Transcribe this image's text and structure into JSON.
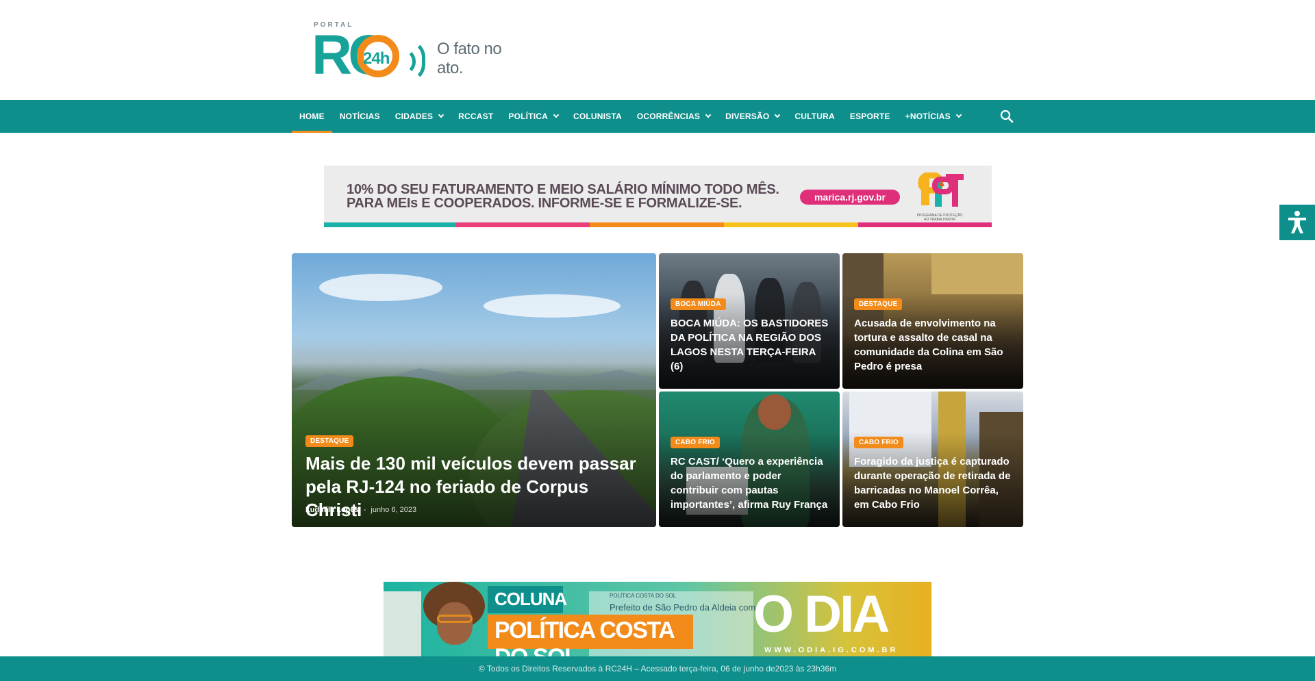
{
  "header": {
    "logo_top": "PORTAL",
    "logo_main": "RC",
    "logo_24h": "24h",
    "tagline": "O fato no ato."
  },
  "nav": {
    "items": [
      {
        "label": "HOME",
        "dropdown": false,
        "active": true
      },
      {
        "label": "NOTÍCIAS",
        "dropdown": false
      },
      {
        "label": "CIDADES",
        "dropdown": true
      },
      {
        "label": "RCCAST",
        "dropdown": false
      },
      {
        "label": "POLÍTICA",
        "dropdown": true
      },
      {
        "label": "COLUNISTA",
        "dropdown": false
      },
      {
        "label": "OCORRÊNCIAS",
        "dropdown": true
      },
      {
        "label": "DIVERSÃO",
        "dropdown": true
      },
      {
        "label": "CULTURA",
        "dropdown": false
      },
      {
        "label": "ESPORTE",
        "dropdown": false
      },
      {
        "label": "+NOTÍCIAS",
        "dropdown": true
      }
    ],
    "search_icon": "search-icon"
  },
  "ad_top": {
    "line1": "10% DO SEU FATURAMENTO E MEIO SALÁRIO MÍNIMO TODO MÊS.",
    "line2": "PARA MEIs E COOPERADOS. INFORME-SE E FORMALIZE-SE.",
    "url": "marica.rj.gov.br",
    "logo_text": "PPT",
    "logo_caption": "PROGRAMA DE PROTEÇÃO AO TRABALHADOR",
    "stripe_colors": [
      "#18b2a8",
      "#e9407a",
      "#f28b1a",
      "#f7c21c",
      "#e02f7a"
    ]
  },
  "featured": {
    "category": "DESTAQUE",
    "title": "Mais de 130 mil veículos devem passar pela RJ-124 no feriado de Corpus Christi",
    "author": "Ludmila Lopes",
    "separator": "-",
    "date": "junho 6, 2023"
  },
  "cards": [
    {
      "category": "BOCA MIÚDA",
      "title": "BOCA MIÚDA: OS BASTIDORES DA POLÍTICA NA REGIÃO DOS LAGOS NESTA TERÇA-FEIRA (6)"
    },
    {
      "category": "DESTAQUE",
      "title": "Acusada de envolvimento na tortura e assalto de casal na comunidade da Colina em São Pedro é presa"
    },
    {
      "category": "CABO FRIO",
      "title": "RC CAST/ ‘Quero a experiência do parlamento e poder contribuir com pautas importantes’, afirma Ruy França"
    },
    {
      "category": "CABO FRIO",
      "title": "Foragido da justiça é capturado durante operação de retirada de barricadas no Manoel Corrêa, em Cabo Frio"
    }
  ],
  "ad_bottom": {
    "coluna": "COLUNA",
    "politica": "POLÍTICA COSTA DO SOL",
    "paper_small": "POLÍTICA COSTA DO SOL",
    "paper_headline": "Prefeito de São Pedro da Aldeia com c",
    "brand": "O DIA",
    "brand_url": "WWW.ODIA.IG.COM.BR"
  },
  "footer": {
    "text": "© Todos os Direitos Reservados à RC24H – Acessado terça-feira, 06 de junho de2023 às 23h36m"
  },
  "accessibility": {
    "icon": "accessibility-icon"
  },
  "colors": {
    "brand_teal": "#0e8f8c",
    "accent_orange": "#f28b1a"
  }
}
